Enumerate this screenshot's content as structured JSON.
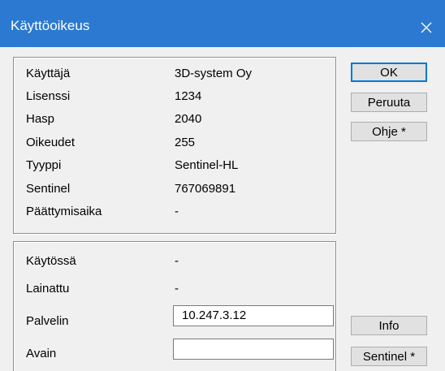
{
  "window": {
    "title": "Käyttöoikeus",
    "close_label": "×"
  },
  "info": [
    {
      "label": "Käyttäjä",
      "value": "3D-system Oy"
    },
    {
      "label": "Lisenssi",
      "value": "1234"
    },
    {
      "label": "Hasp",
      "value": "2040"
    },
    {
      "label": "Oikeudet",
      "value": "255"
    },
    {
      "label": "Tyyppi",
      "value": "Sentinel-HL"
    },
    {
      "label": "Sentinel",
      "value": "767069891"
    },
    {
      "label": "Päättymisaika",
      "value": "-"
    }
  ],
  "status": {
    "kaytossa": {
      "label": "Käytössä",
      "value": "-"
    },
    "lainattu": {
      "label": "Lainattu",
      "value": "-"
    },
    "palvelin": {
      "label": "Palvelin",
      "value": "10.247.3.12"
    },
    "avain": {
      "label": "Avain",
      "value": ""
    }
  },
  "buttons": {
    "ok": "OK",
    "cancel": "Peruuta",
    "help": "Ohje *",
    "info": "Info",
    "sentinel": "Sentinel *"
  },
  "colors": {
    "titlebar": "#2b79d0",
    "accent": "#0078d7"
  }
}
